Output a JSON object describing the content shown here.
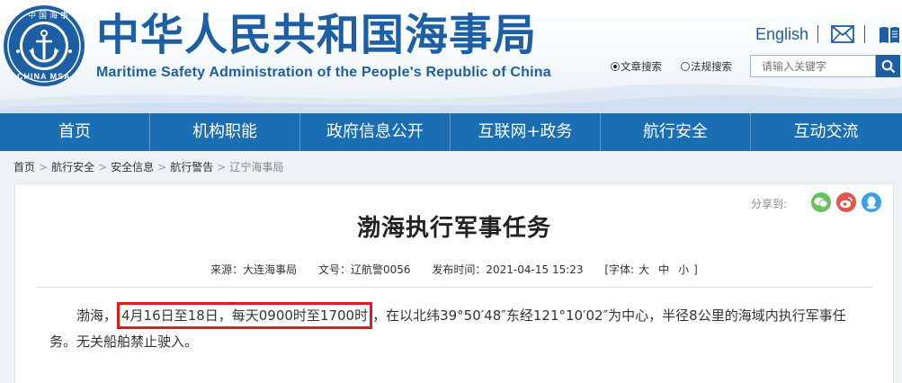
{
  "header": {
    "title_cn": "中华人民共和国海事局",
    "title_en": "Maritime Safety Administration of the People's Republic of China",
    "logo_text_top": "中国海事",
    "logo_text_bottom": "CHINA MSA",
    "lang_link": "English",
    "search": {
      "option_article": "文章搜索",
      "option_regulation": "法规搜索",
      "selected": "文章搜索",
      "placeholder": "请输入关键字"
    },
    "brand_color": "#1c5fa5"
  },
  "nav": {
    "items": [
      "首页",
      "机构职能",
      "政府信息公开",
      "互联网+政务",
      "航行安全",
      "互动交流"
    ],
    "color": "#1a6fb4"
  },
  "breadcrumb": {
    "items": [
      "首页",
      "航行安全",
      "安全信息",
      "航行警告"
    ],
    "current": "辽宁海事局",
    "separator": ">"
  },
  "article": {
    "share_label": "分享到:",
    "share_icons": [
      "wechat-icon",
      "weibo-icon",
      "qq-icon"
    ],
    "title": "渤海执行军事任务",
    "meta": {
      "source": "来源：大连海事局",
      "doc_no": "文号：辽航警0056",
      "publish_time": "发布时间：2021-04-15 15:23",
      "font_label": "[字体:",
      "font_large": "大",
      "font_medium": "中",
      "font_small": "小",
      "font_close": "]"
    },
    "body": {
      "prefix": "渤海，",
      "highlight": "4月16日至18日，每天0900时至1700时",
      "suffix": "，在以北纬39°50′48″东经121°10′02″为中心，半径8公里的海域内执行军事任务。无关船舶禁止驶入。",
      "highlight_color": "#e01b1b"
    }
  }
}
